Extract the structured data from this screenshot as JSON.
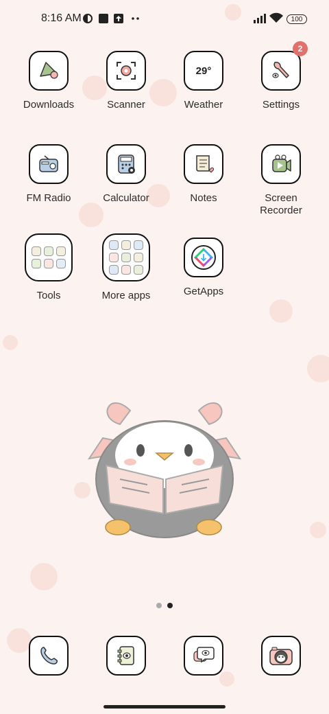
{
  "status_bar": {
    "time": "8:16 AM",
    "battery": "100",
    "icons": [
      "data-saver-icon",
      "notification-square-icon",
      "upload-icon",
      "more-dots-icon",
      "signal-icon",
      "wifi-icon",
      "battery-icon"
    ]
  },
  "apps": [
    {
      "label": "Downloads",
      "icon": "downloads-icon"
    },
    {
      "label": "Scanner",
      "icon": "scanner-icon"
    },
    {
      "label": "Weather",
      "icon": "weather-icon",
      "value": "29°"
    },
    {
      "label": "Settings",
      "icon": "settings-icon",
      "badge": "2"
    },
    {
      "label": "FM Radio",
      "icon": "radio-icon"
    },
    {
      "label": "Calculator",
      "icon": "calculator-icon"
    },
    {
      "label": "Notes",
      "icon": "notes-icon"
    },
    {
      "label": "Screen\nRecorder",
      "icon": "screen-recorder-icon"
    },
    {
      "label": "Tools",
      "icon": "folder-icon"
    },
    {
      "label": "More apps",
      "icon": "folder-icon"
    },
    {
      "label": "GetApps",
      "icon": "getapps-icon"
    }
  ],
  "page_indicator": {
    "pages": 2,
    "current": 2
  },
  "dock": [
    {
      "icon": "phone-icon"
    },
    {
      "icon": "contacts-icon"
    },
    {
      "icon": "messages-icon"
    },
    {
      "icon": "camera-icon"
    }
  ],
  "colors": {
    "background": "#fcf3f0",
    "badge": "#e0716d",
    "tile_border": "#111111"
  }
}
